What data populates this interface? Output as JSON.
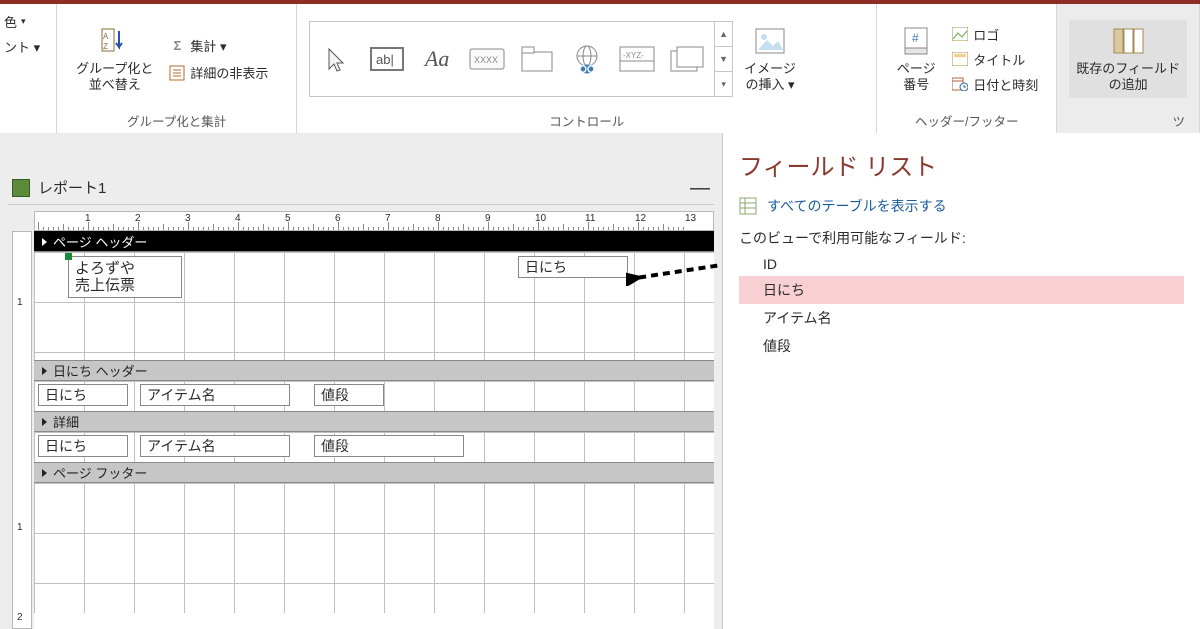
{
  "ribbon": {
    "color_btn": "色",
    "sort_btn": "グループ化と\n並べ替え",
    "font_partial": "ント ▾",
    "totals": "集計 ▾",
    "hide_details": "詳細の非表示",
    "group_label": "グループ化と集計",
    "image_insert": "イメージ\nの挿入 ▾",
    "controls_label": "コントロール",
    "page_number": "ページ\n番号",
    "logo": "ロゴ",
    "title": "タイトル",
    "datetime": "日付と時刻",
    "headerfooter_label": "ヘッダー/フッター",
    "existing_fields": "既存のフィールド\nの追加",
    "tools_partial": "ツ"
  },
  "tab": {
    "title": "レポート1",
    "minimize": "—"
  },
  "ruler_h": [
    "1",
    "2",
    "3",
    "4",
    "5",
    "6",
    "7",
    "8",
    "9",
    "10",
    "11",
    "12",
    "13"
  ],
  "ruler_v_top": [
    "1"
  ],
  "ruler_v_bottom": [
    "1",
    "2"
  ],
  "sections": {
    "page_header": "ページ ヘッダー",
    "date_header": "日にち ヘッダー",
    "detail": "詳細",
    "page_footer": "ページ フッター"
  },
  "controls": {
    "title_label": "よろずや\n売上伝票",
    "date_field": "日にち",
    "dh_date": "日にち",
    "dh_item": "アイテム名",
    "dh_price": "値段",
    "d_date": "日にち",
    "d_item": "アイテム名",
    "d_price": "値段"
  },
  "fieldlist": {
    "title": "フィールド リスト",
    "show_all": "すべてのテーブルを表示する",
    "caption": "このビューで利用可能なフィールド:",
    "items": [
      "ID",
      "日にち",
      "アイテム名",
      "値段"
    ]
  }
}
